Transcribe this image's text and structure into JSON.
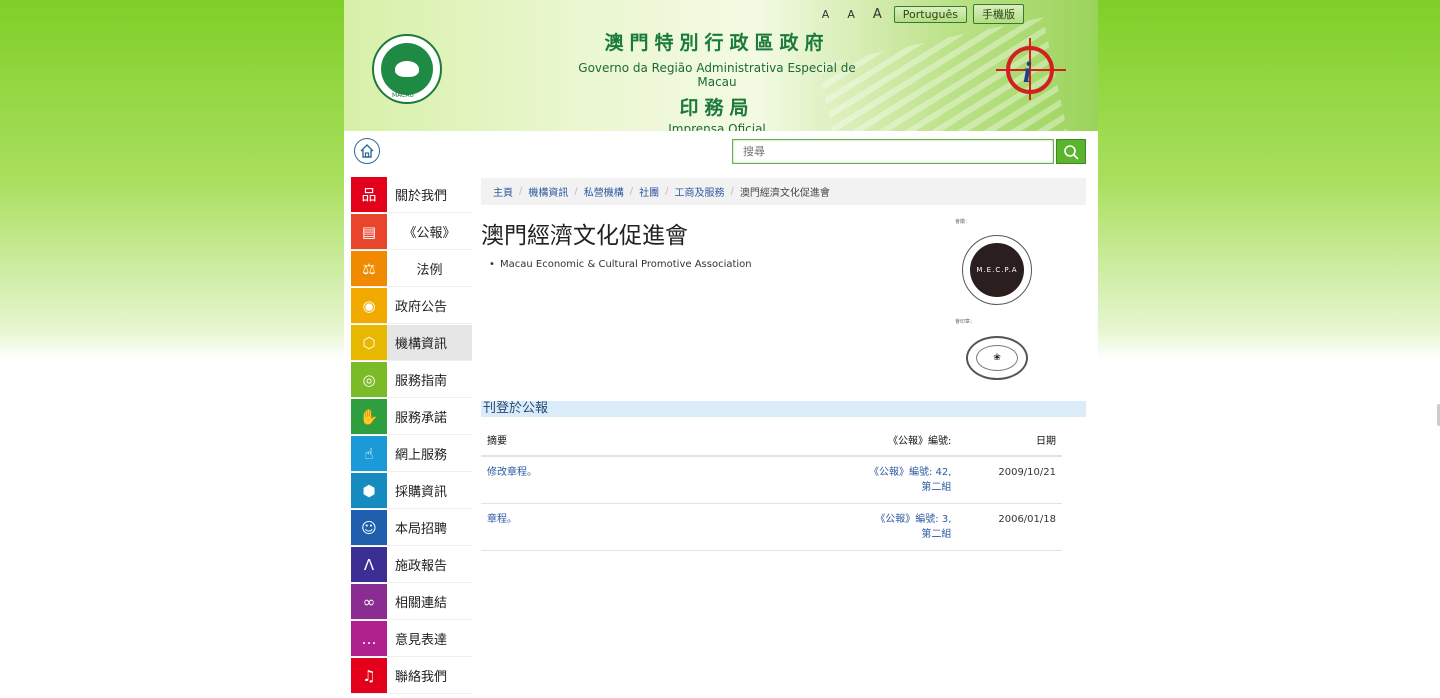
{
  "header": {
    "title_zh": "澳門特別行政區政府",
    "title_pt": "Governo da Região Administrativa Especial de Macau",
    "dept_zh": "印務局",
    "dept_pt": "Imprensa Oficial",
    "emblem_label": "MACAU",
    "font_sizes": [
      "A",
      "A",
      "A"
    ],
    "lang_button": "Português",
    "mobile_button": "手機版"
  },
  "search": {
    "placeholder": "搜尋"
  },
  "sidebar": {
    "items": [
      {
        "label": "關於我們",
        "color": "#e2001a",
        "icon": "org-chart-icon"
      },
      {
        "label": "《公報》",
        "color": "#e9442c",
        "icon": "gazette-icon"
      },
      {
        "label": "法例",
        "color": "#f08a00",
        "icon": "scale-icon"
      },
      {
        "label": "政府公告",
        "color": "#f2a900",
        "icon": "broadcast-icon"
      },
      {
        "label": "機構資訊",
        "color": "#e6b800",
        "icon": "building-icon"
      },
      {
        "label": "服務指南",
        "color": "#7cbb28",
        "icon": "lifebuoy-icon"
      },
      {
        "label": "服務承諾",
        "color": "#2e9e3f",
        "icon": "hand-icon"
      },
      {
        "label": "網上服務",
        "color": "#1a9bd7",
        "icon": "pointer-hand-icon"
      },
      {
        "label": "採購資訊",
        "color": "#168bbf",
        "icon": "box-icon"
      },
      {
        "label": "本局招聘",
        "color": "#1f5fae",
        "icon": "people-icon"
      },
      {
        "label": "施政報告",
        "color": "#3b2f93",
        "icon": "compass-icon"
      },
      {
        "label": "相關連結",
        "color": "#8a2c92",
        "icon": "link-icon"
      },
      {
        "label": "意見表達",
        "color": "#b0218e",
        "icon": "speech-bubble-icon"
      },
      {
        "label": "聯絡我們",
        "color": "#e2001a",
        "icon": "headset-icon"
      }
    ],
    "active_index": 4
  },
  "breadcrumb": {
    "items": [
      "主頁",
      "機構資訊",
      "私營機構",
      "社團",
      "工商及服務"
    ],
    "current": "澳門經濟文化促進會"
  },
  "main": {
    "title": "澳門經濟文化促進會",
    "english_name": "Macau Economic & Cultural Promotive Association",
    "badge_label": "會徽：",
    "badge_text": "M.E.C.P.A",
    "seal_label": "會印章："
  },
  "publications": {
    "section_title": "刊登於公報",
    "headers": {
      "summary": "摘要",
      "gazette": "《公報》編號:",
      "date": "日期"
    },
    "rows": [
      {
        "summary": "修改章程。",
        "gazette_line1": "《公報》編號: 42,",
        "gazette_line2": "第二組",
        "date": "2009/10/21"
      },
      {
        "summary": "章程。",
        "gazette_line1": "《公報》編號: 3,",
        "gazette_line2": "第二組",
        "date": "2006/01/18"
      }
    ]
  },
  "colors": {
    "accent_green": "#5cb32e",
    "link_blue": "#2c5aa0",
    "section_bg": "#d9ecf7"
  }
}
